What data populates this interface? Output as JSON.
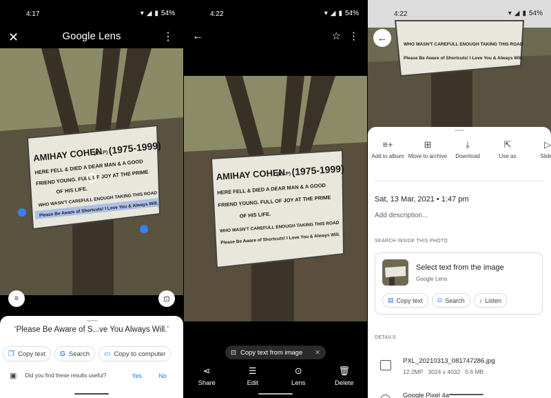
{
  "panel1": {
    "status": {
      "time": "4:17",
      "battery": "54%"
    },
    "title": "Google Lens",
    "result_quote": "‘Please Be Aware of S...ve You Always Will.’",
    "chips": [
      {
        "icon": "copy-icon",
        "label": "Copy text"
      },
      {
        "icon": "google-g-icon",
        "label": "Search"
      },
      {
        "icon": "computer-icon",
        "label": "Copy to computer"
      }
    ],
    "feedback": {
      "question": "Did you find these results useful?",
      "yes": "Yes",
      "no": "No"
    }
  },
  "panel2": {
    "status": {
      "time": "4:22",
      "battery": "54%"
    },
    "pill_label": "Copy text from image",
    "actions": [
      {
        "icon": "share-icon",
        "label": "Share"
      },
      {
        "icon": "edit-icon",
        "label": "Edit"
      },
      {
        "icon": "lens-icon",
        "label": "Lens"
      },
      {
        "icon": "delete-icon",
        "label": "Delete"
      }
    ]
  },
  "panel3": {
    "status": {
      "time": "4:22",
      "battery": "54%"
    },
    "actions": [
      {
        "icon": "add-to-album-icon",
        "label": "Add to album"
      },
      {
        "icon": "archive-icon",
        "label": "Move to archive"
      },
      {
        "icon": "download-icon",
        "label": "Download"
      },
      {
        "icon": "use-as-icon",
        "label": "Use as"
      },
      {
        "icon": "slideshow-icon",
        "label": "Slides"
      }
    ],
    "date": "Sat, 13 Mar, 2021 • 1:47 pm",
    "description_placeholder": "Add description...",
    "search_section_title": "SEARCH INSIDE THIS PHOTO",
    "lens_card": {
      "title": "Select text from the image",
      "subtitle": "Google Lens",
      "chips": [
        {
          "icon": "doc-icon",
          "label": "Copy text"
        },
        {
          "icon": "lens-icon",
          "label": "Search"
        },
        {
          "icon": "listen-icon",
          "label": "Listen"
        }
      ]
    },
    "details_section_title": "DETAILS",
    "file": {
      "name": "PXL_20210313_081747286.jpg",
      "megapixels": "12.2MP",
      "dimensions": "3024 x 4032",
      "size": "5.6 MB"
    },
    "device": "Google Pixel 4a"
  },
  "sign": {
    "line1": "AMIHAY COHEN",
    "rip": "(R.I.P)",
    "years": "(1975-1999)",
    "line2": "HERE FELL & DIED A DEAR MAN & A GOOD",
    "line3": "FRIEND YOUNG. FULL OF JOY AT THE PRIME",
    "line4": "OF HIS LIFE.",
    "line5": "WHO WASN'T CAREFULL ENOUGH TAKING THIS ROAD",
    "line6": "Please Be Aware of Shortcuts! I Love You & Always Will."
  }
}
